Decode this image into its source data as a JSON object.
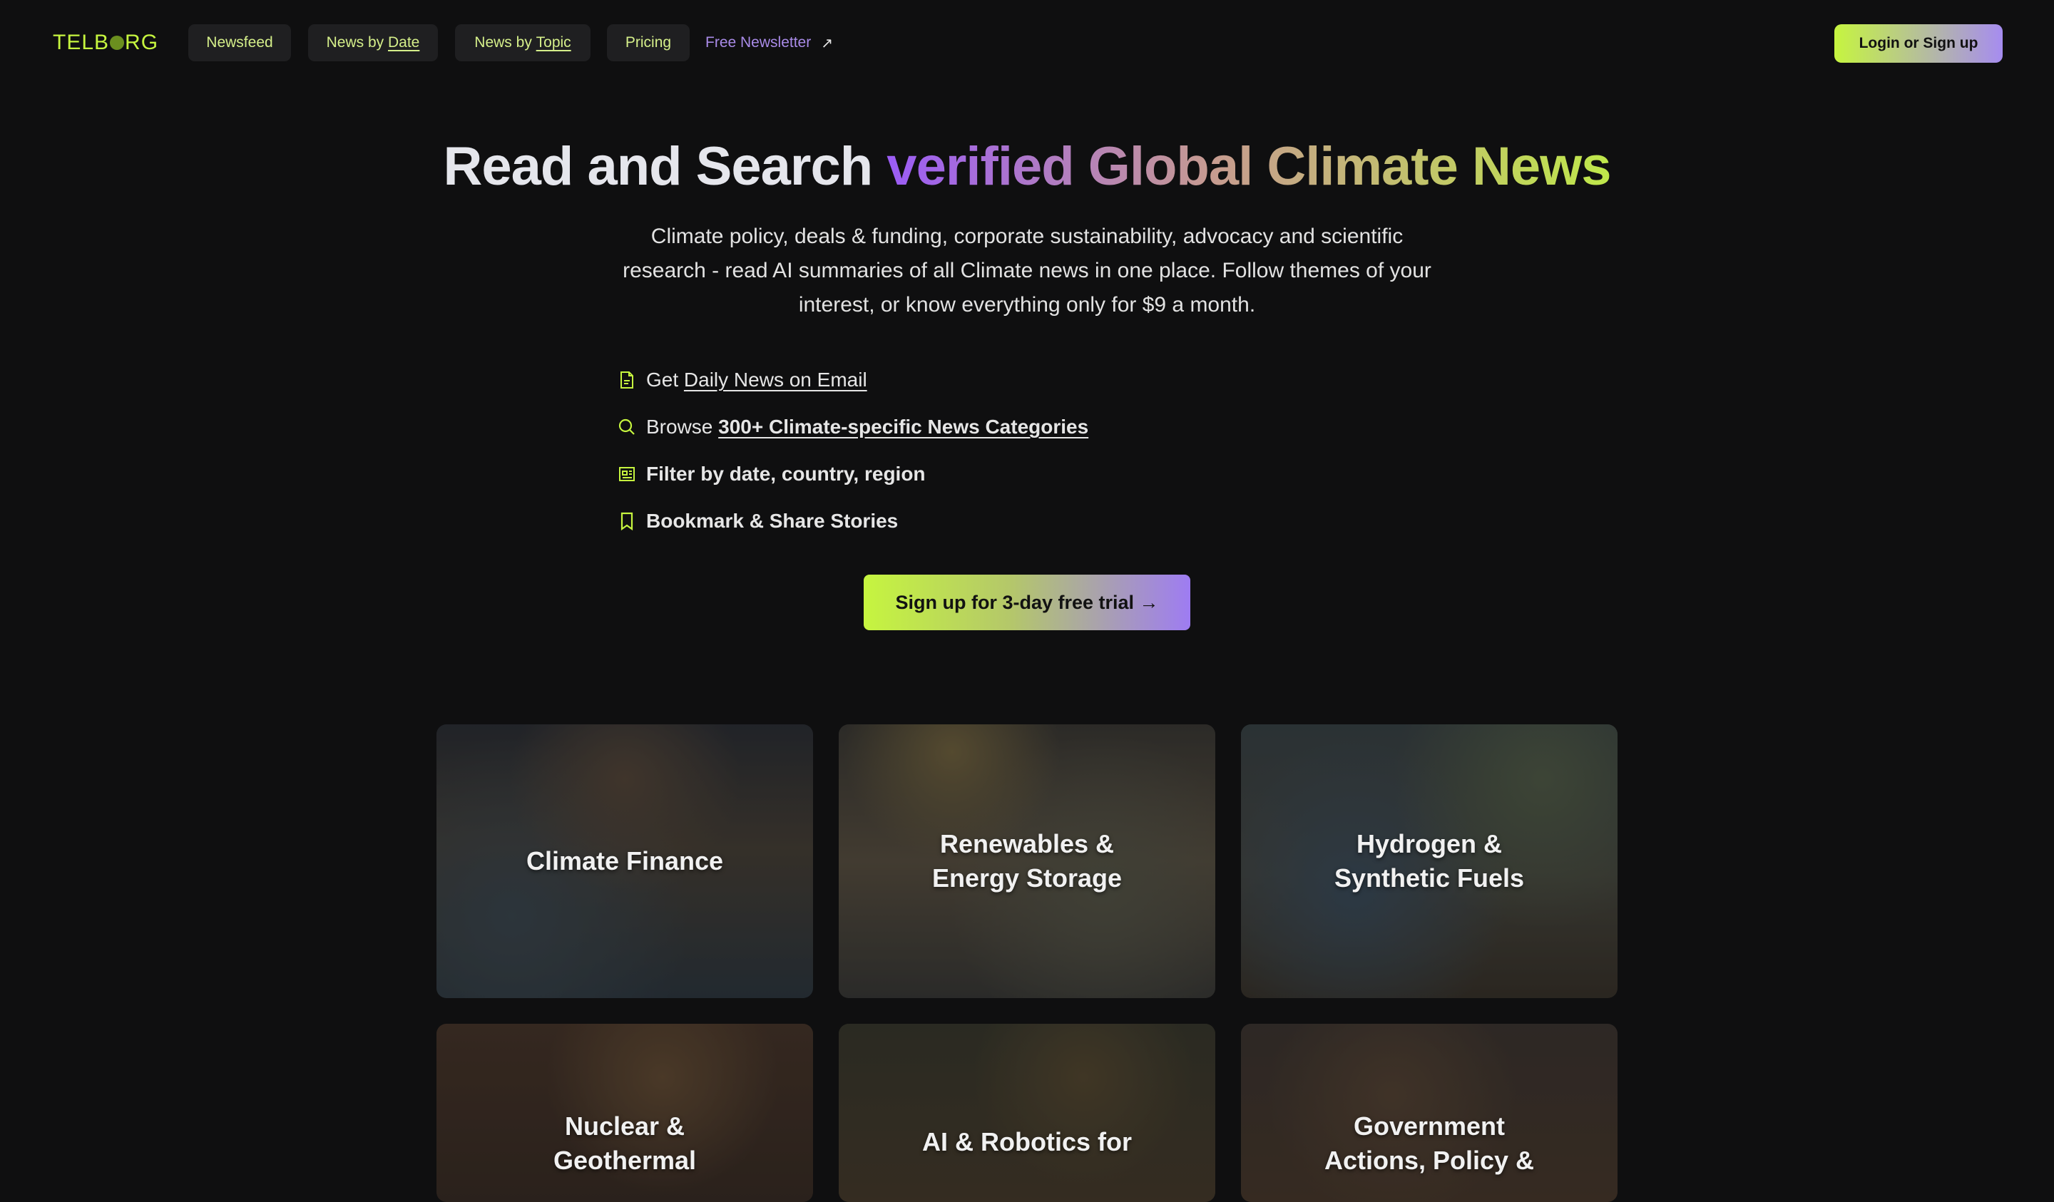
{
  "brand": {
    "logo_left": "TELB",
    "logo_right": "RG"
  },
  "nav": {
    "newsfeed": "Newsfeed",
    "by_date_prefix": "News by ",
    "by_date_link": "Date",
    "by_topic_prefix": "News by ",
    "by_topic_link": "Topic",
    "pricing": "Pricing",
    "newsletter": "Free Newsletter",
    "login": "Login or Sign up"
  },
  "hero": {
    "title_plain": "Read and Search ",
    "title_grad": "verified Global Climate News",
    "subtitle": "Climate policy, deals & funding, corporate sustainability, advocacy and scientific research - read AI summaries of all Climate news in one place. Follow themes of your interest, or know everything only for $9 a month."
  },
  "features": [
    {
      "icon": "document-icon",
      "prefix": "Get ",
      "link": "Daily News on Email"
    },
    {
      "icon": "search-icon",
      "prefix": "Browse ",
      "link": "300+ Climate-specific News Categories"
    },
    {
      "icon": "newspaper-icon",
      "text": "Filter by date, country, region"
    },
    {
      "icon": "bookmark-icon",
      "text": "Bookmark & Share Stories"
    }
  ],
  "cta": "Sign up for 3-day free trial →",
  "categories": [
    "Climate Finance",
    "Renewables &\nEnergy Storage",
    "Hydrogen &\nSynthetic Fuels",
    "Nuclear &\nGeothermal",
    "AI & Robotics for",
    "Government\nActions, Policy &"
  ],
  "colors": {
    "accent_green": "#c6f53f",
    "accent_purple": "#9b5cf6",
    "background": "#0f0f10"
  }
}
